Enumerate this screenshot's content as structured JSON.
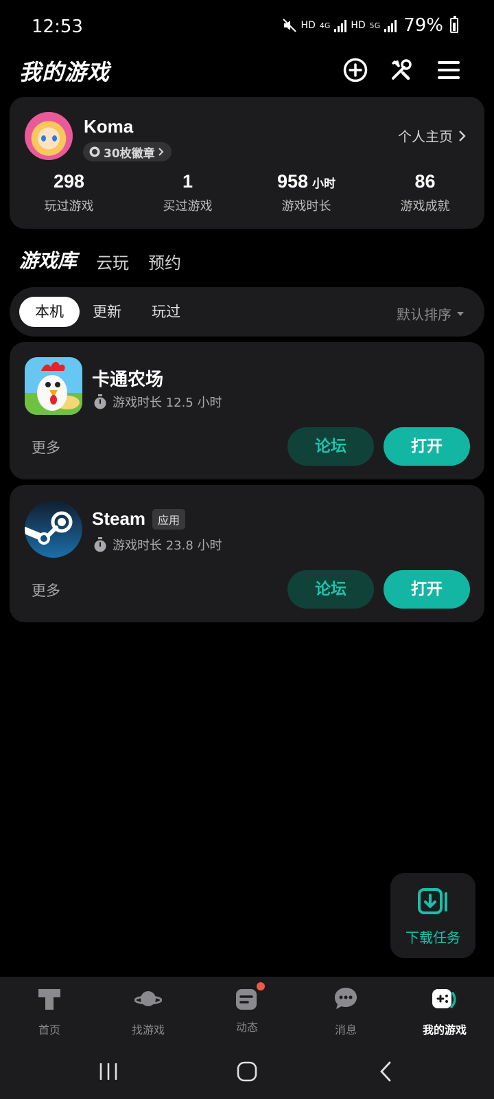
{
  "status_bar": {
    "time": "12:53",
    "hd1": "HD",
    "net1": "4G",
    "hd2": "HD",
    "net2": "5G",
    "battery": "79%"
  },
  "header": {
    "title": "我的游戏"
  },
  "profile": {
    "username": "Koma",
    "badges": "30枚徽章",
    "profile_link": "个人主页",
    "stats": [
      {
        "value": "298",
        "unit": "",
        "label": "玩过游戏"
      },
      {
        "value": "1",
        "unit": "",
        "label": "买过游戏"
      },
      {
        "value": "958",
        "unit": "小时",
        "label": "游戏时长"
      },
      {
        "value": "86",
        "unit": "",
        "label": "游戏成就"
      }
    ]
  },
  "library_tabs": [
    "游戏库",
    "云玩",
    "预约"
  ],
  "filter": {
    "chips": [
      "本机",
      "更新",
      "玩过"
    ],
    "sort": "默认排序"
  },
  "games": [
    {
      "name": "卡通农场",
      "tag": "",
      "playtime": "游戏时长 12.5 小时",
      "more": "更多",
      "forum": "论坛",
      "open": "打开",
      "icon": "hay-day-icon"
    },
    {
      "name": "Steam",
      "tag": "应用",
      "playtime": "游戏时长 23.8 小时",
      "more": "更多",
      "forum": "论坛",
      "open": "打开",
      "icon": "steam-icon"
    }
  ],
  "download": {
    "label": "下载任务"
  },
  "bottom_nav": [
    {
      "label": "首页",
      "active": false
    },
    {
      "label": "找游戏",
      "active": false
    },
    {
      "label": "动态",
      "active": false,
      "badge": true
    },
    {
      "label": "消息",
      "active": false
    },
    {
      "label": "我的游戏",
      "active": true
    }
  ],
  "colors": {
    "accent": "#13b6a2",
    "card": "#1c1c1e",
    "forum_bg": "#114239",
    "badge_red": "#f2584a"
  }
}
